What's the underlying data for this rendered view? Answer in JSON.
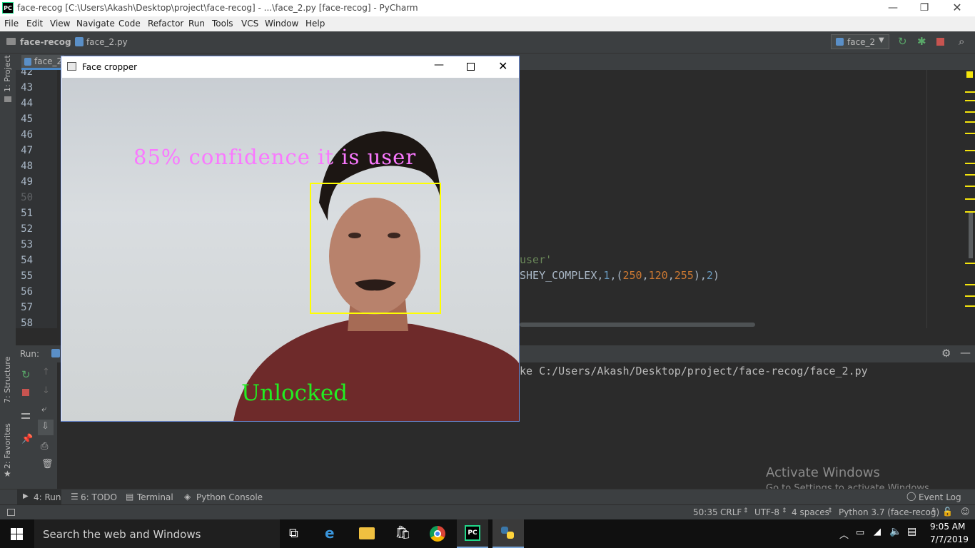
{
  "app": {
    "window_title": "face-recog [C:\\Users\\Akash\\Desktop\\project\\face-recog] - ...\\face_2.py [face-recog] - PyCharm",
    "logo_text": "PC"
  },
  "menu": [
    "File",
    "Edit",
    "View",
    "Navigate",
    "Code",
    "Refactor",
    "Run",
    "Tools",
    "VCS",
    "Window",
    "Help"
  ],
  "nav": {
    "project": "face-recog",
    "file": "face_2.py",
    "run_config": "face_2"
  },
  "left_strip": {
    "project": "1: Project",
    "structure": "7: Structure",
    "favorites": "2: Favorites"
  },
  "editor": {
    "tab": "face_2.py",
    "line_numbers": [
      "42",
      "43",
      "44",
      "45",
      "46",
      "47",
      "48",
      "49",
      "50",
      "51",
      "52",
      "53",
      "54",
      "55",
      "56",
      "57",
      "58"
    ],
    "code_line_54": "user'",
    "code_line_55_prefix": "SHEY_COMPLEX,",
    "code_line_55_n1": "1",
    "code_line_55_mid": ",(",
    "code_line_55_c1": "250",
    "code_line_55_c2": "120",
    "code_line_55_c3": "255",
    "code_line_55_end": "),",
    "code_line_55_n2": "2",
    "code_line_55_close": ")"
  },
  "run_panel": {
    "label": "Run:",
    "console_line": "ke C:/Users/Akash/Desktop/project/face-recog/face_2.py"
  },
  "bottom_tabs": {
    "run": "4: Run",
    "todo": "6: TODO",
    "terminal": "Terminal",
    "python_console": "Python Console",
    "event_log": "Event Log"
  },
  "status": {
    "position": "50:35",
    "line_sep": "CRLF",
    "encoding": "UTF-8",
    "indent": "4 spaces",
    "interpreter": "Python 3.7 (face-recog)"
  },
  "watermark": {
    "title": "Activate Windows",
    "subtitle": "Go to Settings to activate Windows."
  },
  "face_window": {
    "title": "Face cropper",
    "confidence_text": "85% confidence it is user",
    "status_text": "Unlocked"
  },
  "taskbar": {
    "search_placeholder": "Search the web and Windows",
    "time": "9:05 AM",
    "date": "7/7/2019"
  },
  "colors": {
    "accent_pink": "#fa78ff",
    "unlocked_green": "#22ee22",
    "face_box_yellow": "#ffff00",
    "number_orange": "#cc7832",
    "number_blue": "#6897bb"
  }
}
